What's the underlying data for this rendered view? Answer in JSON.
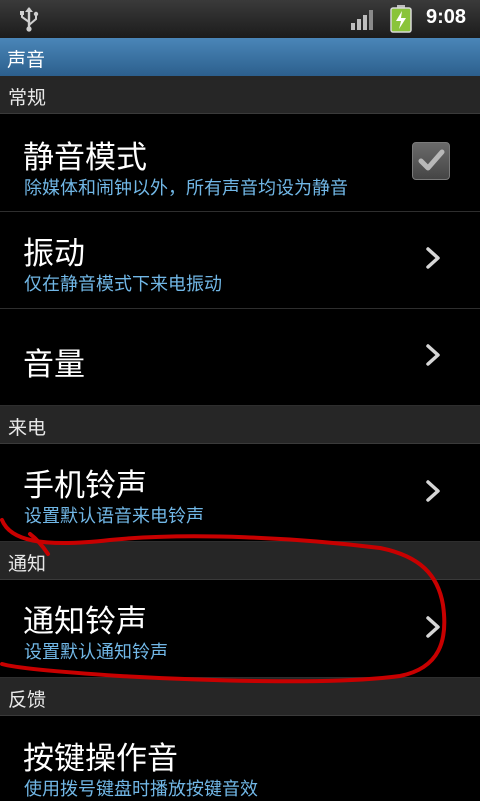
{
  "status_bar": {
    "time": "9:08",
    "icons": [
      "usb-icon",
      "signal-icon",
      "battery-charging-icon"
    ]
  },
  "title_bar": {
    "title": "声音"
  },
  "sections": {
    "general": {
      "label": "常规"
    },
    "incoming_call": {
      "label": "来电"
    },
    "notification": {
      "label": "通知"
    },
    "feedback": {
      "label": "反馈"
    }
  },
  "items": {
    "silent_mode": {
      "title": "静音模式",
      "summary": "除媒体和闹钟以外，所有声音均设为静音",
      "checked": true,
      "control_icon": "checkbox-checked-icon"
    },
    "vibrate": {
      "title": "振动",
      "summary": "仅在静音模式下来电振动",
      "control_icon": "chevron-right-icon"
    },
    "volume": {
      "title": "音量",
      "control_icon": "chevron-right-icon"
    },
    "phone_ringtone": {
      "title": "手机铃声",
      "summary": "设置默认语音来电铃声",
      "control_icon": "chevron-right-icon"
    },
    "notification_ringtone": {
      "title": "通知铃声",
      "summary": "设置默认通知铃声",
      "control_icon": "chevron-right-icon"
    },
    "keypad_tones": {
      "title": "按键操作音",
      "summary": "使用拨号键盘时播放按键音效"
    }
  },
  "colors": {
    "title_bar": "#3a74a6",
    "summary_text": "#71b7e6",
    "section_header": "#262626",
    "annotation_stroke": "#c80000"
  }
}
